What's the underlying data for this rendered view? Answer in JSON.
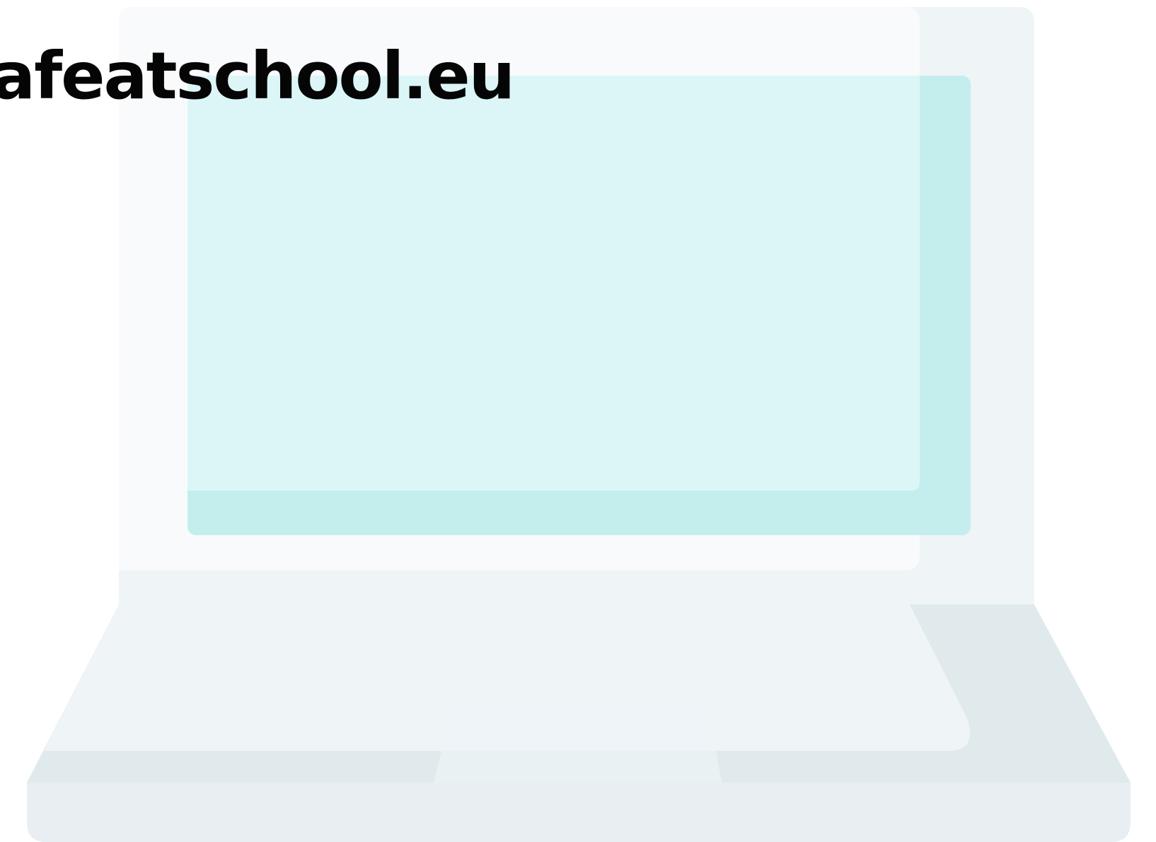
{
  "site": {
    "title": "afeatschool.eu"
  },
  "colors": {
    "screen_back": "#eff4f7",
    "screen_front": "#f9fafc",
    "display_back": "#c4eeee",
    "display_front": "#dcf6f7",
    "base_top": "#eff4f7",
    "base_shadow": "#e0e9ec",
    "base_front": "#e8eef1",
    "text": "#050505"
  },
  "icons": {
    "illustration": "laptop-icon"
  }
}
